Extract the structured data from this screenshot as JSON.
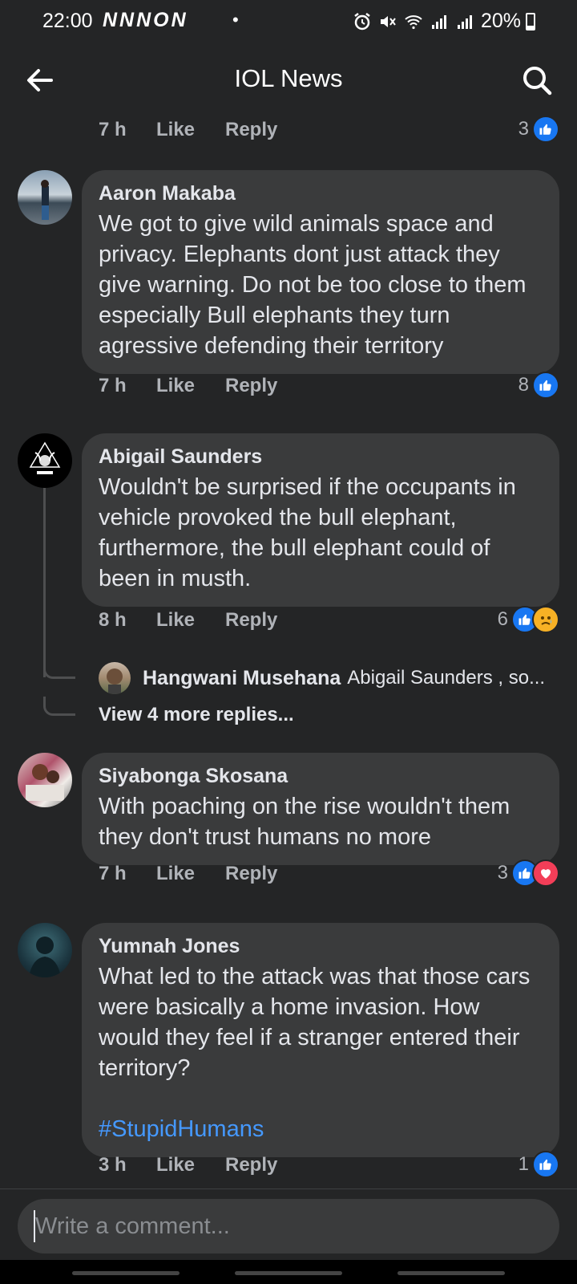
{
  "status_bar": {
    "time": "22:00",
    "notif_icons": "NNNON",
    "dot": "•",
    "battery": "20%",
    "icons": [
      "alarm-icon",
      "mute-icon",
      "wifi-icon",
      "signal-icon",
      "signal-icon",
      "battery-icon"
    ]
  },
  "header": {
    "title": "IOL News",
    "back_icon": "arrow-left-icon",
    "search_icon": "search-icon"
  },
  "colors": {
    "background": "#242526",
    "bubble": "#3a3b3c",
    "text": "#e4e6eb",
    "muted": "#b0b3b8",
    "like": "#1877f2",
    "love": "#f33e58",
    "sad": "#f7b125",
    "hashtag": "#4599ff"
  },
  "top_meta": {
    "time": "7 h",
    "like": "Like",
    "reply": "Reply",
    "reaction_count": "3",
    "reactions": [
      "like"
    ]
  },
  "comments": [
    {
      "author": "Aaron Makaba",
      "text": "We got to give wild animals space and privacy. Elephants dont just attack they give warning. Do not be too close to them especially Bull elephants they turn agressive defending their territory",
      "time": "7 h",
      "like": "Like",
      "reply": "Reply",
      "reaction_count": "8",
      "reactions": [
        "like"
      ]
    },
    {
      "author": "Abigail Saunders",
      "text": "Wouldn't be surprised if the occupants in vehicle provoked the bull elephant, furthermore, the bull elephant could of been in musth.",
      "time": "8 h",
      "like": "Like",
      "reply": "Reply",
      "reaction_count": "6",
      "reactions": [
        "like",
        "sad"
      ],
      "reply_preview": {
        "author": "Hangwani Musehana",
        "snippet": "Abigail Saunders , so..."
      },
      "view_more": "View 4 more replies..."
    },
    {
      "author": "Siyabonga Skosana",
      "text": "With poaching on the rise wouldn't them they don't trust humans no more",
      "time": "7 h",
      "like": "Like",
      "reply": "Reply",
      "reaction_count": "3",
      "reactions": [
        "like",
        "love"
      ]
    },
    {
      "author": "Yumnah Jones",
      "text": "What led to the attack was that those cars were basically a home invasion. How would they feel if a stranger entered their territory?",
      "hashtag": "#StupidHumans",
      "time": "3 h",
      "like": "Like",
      "reply": "Reply",
      "reaction_count": "1",
      "reactions": [
        "like"
      ]
    }
  ],
  "composer": {
    "placeholder": "Write a comment..."
  }
}
